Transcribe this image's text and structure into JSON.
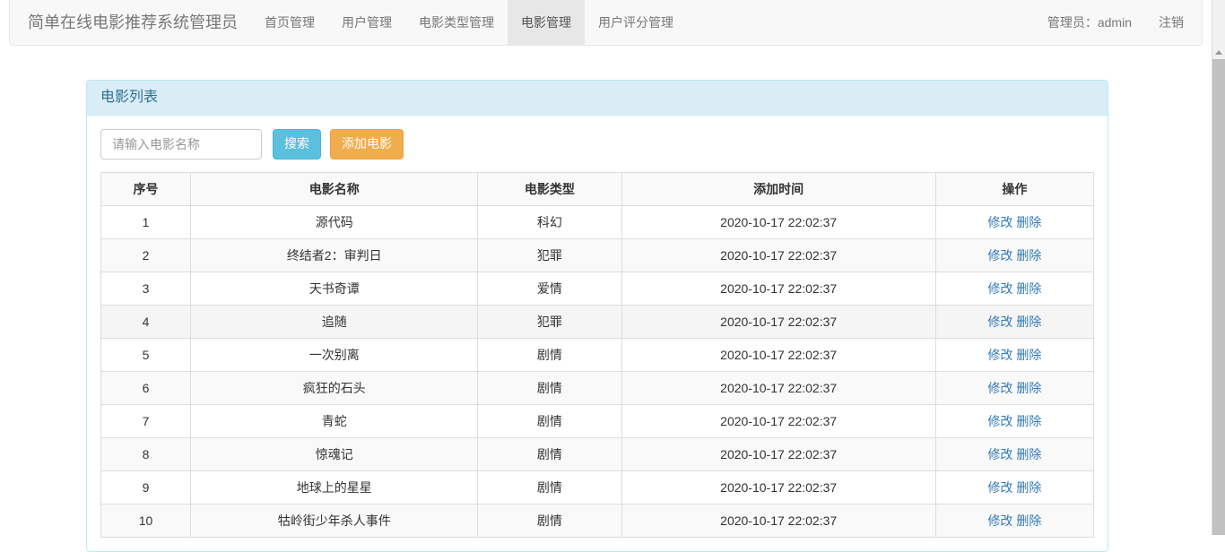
{
  "navbar": {
    "brand": "简单在线电影推荐系统管理员",
    "items": [
      {
        "label": "首页管理",
        "active": false
      },
      {
        "label": "用户管理",
        "active": false
      },
      {
        "label": "电影类型管理",
        "active": false
      },
      {
        "label": "电影管理",
        "active": true
      },
      {
        "label": "用户评分管理",
        "active": false
      }
    ],
    "user_label": "管理员：admin",
    "logout_label": "注销"
  },
  "panel": {
    "title": "电影列表"
  },
  "search": {
    "placeholder": "请输入电影名称",
    "value": "",
    "search_button": "搜索",
    "add_button": "添加电影"
  },
  "table": {
    "headers": [
      "序号",
      "电影名称",
      "电影类型",
      "添加时间",
      "操作"
    ],
    "op_edit": "修改",
    "op_delete": "删除",
    "rows": [
      {
        "idx": "1",
        "name": "源代码",
        "type": "科幻",
        "time": "2020-10-17 22:02:37"
      },
      {
        "idx": "2",
        "name": "终结者2：审判日",
        "type": "犯罪",
        "time": "2020-10-17 22:02:37"
      },
      {
        "idx": "3",
        "name": "天书奇谭",
        "type": "爱情",
        "time": "2020-10-17 22:02:37"
      },
      {
        "idx": "4",
        "name": "追随",
        "type": "犯罪",
        "time": "2020-10-17 22:02:37"
      },
      {
        "idx": "5",
        "name": "一次别离",
        "type": "剧情",
        "time": "2020-10-17 22:02:37"
      },
      {
        "idx": "6",
        "name": "疯狂的石头",
        "type": "剧情",
        "time": "2020-10-17 22:02:37"
      },
      {
        "idx": "7",
        "name": "青蛇",
        "type": "剧情",
        "time": "2020-10-17 22:02:37"
      },
      {
        "idx": "8",
        "name": "惊魂记",
        "type": "剧情",
        "time": "2020-10-17 22:02:37"
      },
      {
        "idx": "9",
        "name": "地球上的星星",
        "type": "剧情",
        "time": "2020-10-17 22:02:37"
      },
      {
        "idx": "10",
        "name": "牯岭街少年杀人事件",
        "type": "剧情",
        "time": "2020-10-17 22:02:37"
      }
    ]
  },
  "colors": {
    "panel_border": "#bce8f1",
    "panel_heading_bg": "#d9edf7",
    "panel_heading_text": "#31708f",
    "search_button": "#5bc0de",
    "add_button": "#f0ad4e",
    "link": "#337ab7",
    "navbar_bg": "#f8f8f8",
    "navbar_active_bg": "#e7e7e7"
  },
  "scrollbar": {
    "up_arrow_icon": "scroll-up-arrow-icon"
  }
}
